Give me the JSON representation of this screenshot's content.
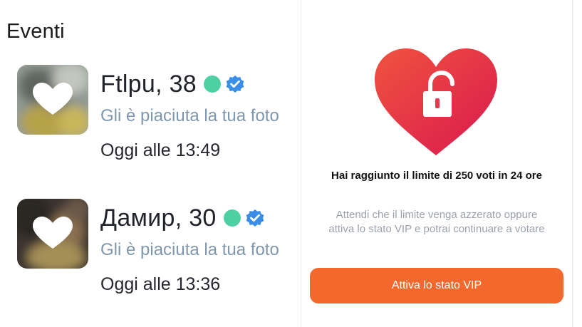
{
  "events": {
    "title": "Eventi",
    "items": [
      {
        "name": "Ftlpu, 38",
        "description": "Gli è piaciuta la tua foto",
        "time": "Oggi alle 13:49",
        "online": true,
        "verified": true,
        "thumb_icon": "heart-icon"
      },
      {
        "name": "Дамир, 30",
        "description": "Gli è piaciuta la tua foto",
        "time": "Oggi alle 13:36",
        "online": true,
        "verified": true,
        "thumb_icon": "heart-icon"
      }
    ]
  },
  "limit_panel": {
    "icon": "heart-unlock-icon",
    "title": "Hai raggiunto il limite di 250 voti in 24 ore",
    "body": "Attendi che il limite venga azzerato oppure attiva lo stato VIP e potrai continuare a votare",
    "button_label": "Attiva lo stato VIP"
  },
  "colors": {
    "online": "#4fd0a3",
    "verified": "#3a8ee6",
    "accent_button": "#f2682d",
    "heart_gradient": [
      "#f0533e",
      "#d9184f"
    ],
    "description_text": "#7f97ad"
  }
}
